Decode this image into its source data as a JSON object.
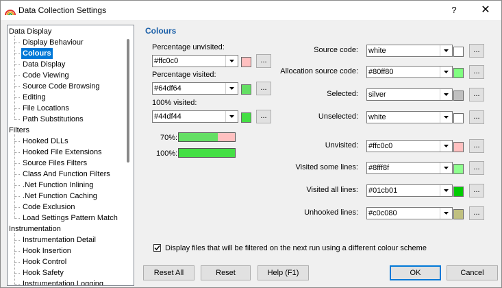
{
  "window": {
    "title": "Data Collection Settings",
    "help_label": "?",
    "close_label": "✕"
  },
  "tree": {
    "groups": [
      {
        "label": "Data Display",
        "items": [
          "Display Behaviour",
          "Colours",
          "Data Display",
          "Code Viewing",
          "Source Code Browsing",
          "Editing",
          "File Locations",
          "Path Substitutions"
        ]
      },
      {
        "label": "Filters",
        "items": [
          "Hooked DLLs",
          "Hooked File Extensions",
          "Source Files Filters",
          "Class And Function Filters",
          ".Net Function Inlining",
          ".Net Function Caching",
          "Code Exclusion",
          "Load Settings Pattern Match"
        ]
      },
      {
        "label": "Instrumentation",
        "items": [
          "Instrumentation Detail",
          "Hook Insertion",
          "Hook Control",
          "Hook Safety",
          "Instrumentation Logging"
        ]
      }
    ],
    "selected": "Colours"
  },
  "section_title": "Colours",
  "left": {
    "pct_unvisited_label": "Percentage unvisited:",
    "pct_unvisited_value": "#ffc0c0",
    "pct_visited_label": "Percentage visited:",
    "pct_visited_value": "#64df64",
    "full_visited_label": "100% visited:",
    "full_visited_value": "#44df44",
    "colors": {
      "unvisited": "#ffc0c0",
      "visited": "#64df64",
      "full": "#44df44"
    },
    "preview_70_label": "70%:",
    "preview_70_fraction": 0.7,
    "preview_100_label": "100%:",
    "preview_100_fraction": 1.0,
    "dots_label": "..."
  },
  "right": {
    "source_code_label": "Source code:",
    "source_code_value": "white",
    "source_code_color": "#ffffff",
    "alloc_label": "Allocation source code:",
    "alloc_value": "#80ff80",
    "alloc_color": "#80ff80",
    "selected_label": "Selected:",
    "selected_value": "silver",
    "selected_color": "#c0c0c0",
    "unselected_label": "Unselected:",
    "unselected_value": "white",
    "unselected_color": "#ffffff",
    "unvisited_label": "Unvisited:",
    "unvisited_value": "#ffc0c0",
    "unvisited_color": "#ffc0c0",
    "visited_some_label": "Visited some lines:",
    "visited_some_value": "#8fff8f",
    "visited_some_color": "#8fff8f",
    "visited_all_label": "Visited all lines:",
    "visited_all_value": "#01cb01",
    "visited_all_color": "#01cb01",
    "unhooked_label": "Unhooked lines:",
    "unhooked_value": "#c0c080",
    "unhooked_color": "#c0c080"
  },
  "checkbox_label": "Display files that will be filtered on the next run using a different colour scheme",
  "checkbox_checked": true,
  "buttons": {
    "reset_all": "Reset All",
    "reset": "Reset",
    "help": "Help (F1)",
    "ok": "OK",
    "cancel": "Cancel"
  }
}
